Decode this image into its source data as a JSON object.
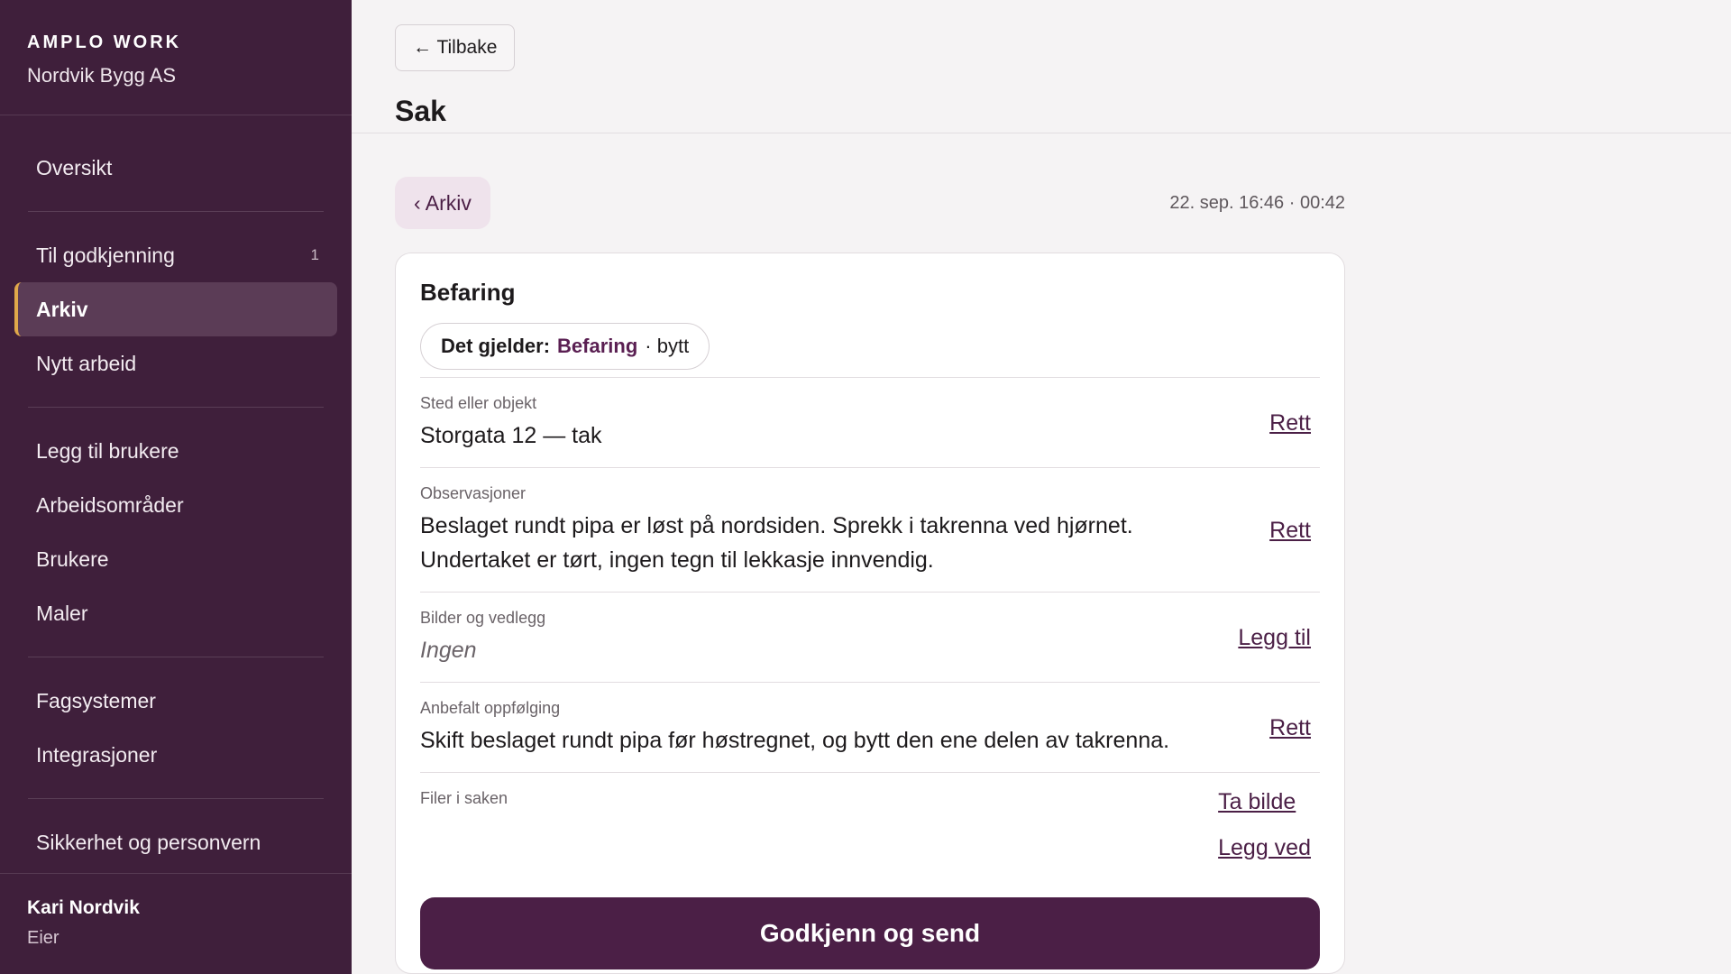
{
  "brand": {
    "name": "AMPLO WORK",
    "org": "Nordvik Bygg AS"
  },
  "nav": {
    "overview": "Oversikt",
    "approval": "Til godkjenning",
    "approval_count": "1",
    "archive": "Arkiv",
    "new_work": "Nytt arbeid",
    "add_users": "Legg til brukere",
    "areas": "Arbeidsområder",
    "users": "Brukere",
    "templates": "Maler",
    "systems": "Fagsystemer",
    "integrations": "Integrasjoner",
    "security": "Sikkerhet og personvern"
  },
  "user": {
    "name": "Kari Nordvik",
    "role": "Eier"
  },
  "header": {
    "back_label": "← Tilbake",
    "title": "Sak"
  },
  "case": {
    "crumb": "‹ Arkiv",
    "timestamp": "22. sep. 16:46 · 00:42",
    "title": "Befaring",
    "chip": {
      "label": "Det gjelder:",
      "value": "Befaring",
      "action": "· bytt"
    },
    "fields": {
      "location": {
        "label": "Sted eller objekt",
        "value": "Storgata 12 — tak",
        "action": "Rett"
      },
      "observations": {
        "label": "Observasjoner",
        "value": "Beslaget rundt pipa er løst på nordsiden. Sprekk i takrenna ved hjørnet. Undertaket er tørt, ingen tegn til lekkasje innvendig.",
        "action": "Rett"
      },
      "attachments": {
        "label": "Bilder og vedlegg",
        "value": "Ingen",
        "action": "Legg til"
      },
      "followup": {
        "label": "Anbefalt oppfølging",
        "value": "Skift beslaget rundt pipa før høstregnet, og bytt den ene delen av takrenna.",
        "action": "Rett"
      },
      "files": {
        "label": "Filer i saken",
        "take_photo": "Ta bilde",
        "attach": "Legg ved"
      }
    },
    "primary_button": "Godkjenn og send"
  },
  "colors": {
    "sidebar": "#3f1f3b",
    "accent": "#4b1f46",
    "active_marker": "#e0a84a"
  }
}
